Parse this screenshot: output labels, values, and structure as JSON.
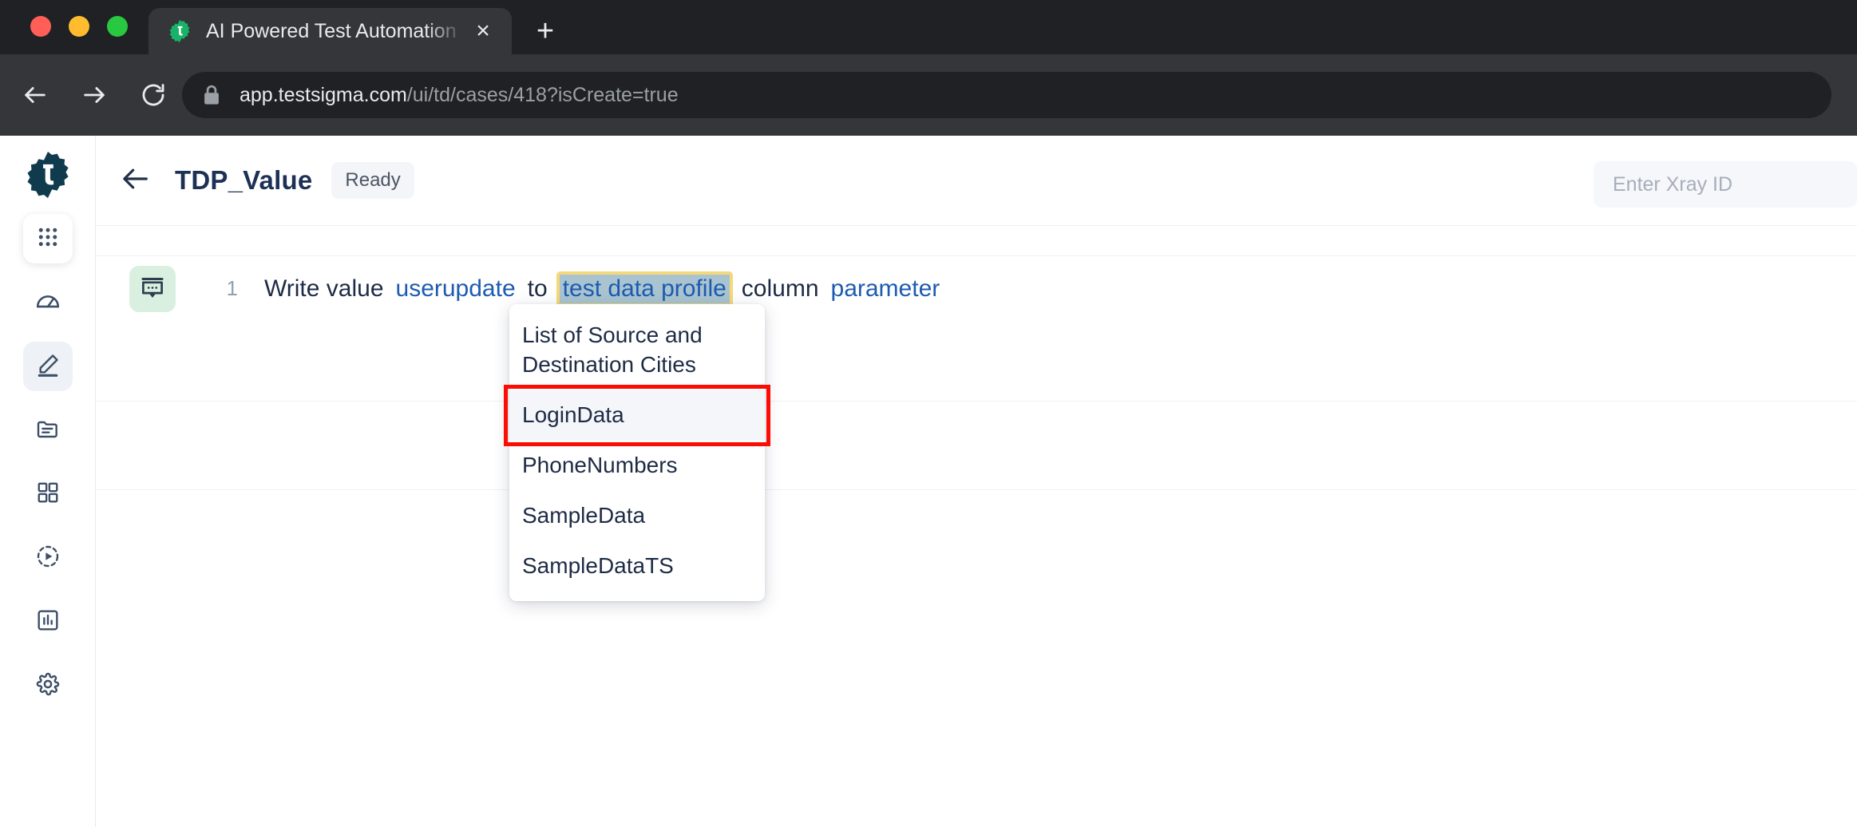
{
  "browser": {
    "tab": {
      "title": "AI Powered Test Automation Pl",
      "favicon_name": "testsigma-logo-icon",
      "close_label": "×"
    },
    "new_tab_label": "+",
    "nav": {
      "back_name": "back-button",
      "forward_name": "forward-button",
      "reload_name": "reload-button"
    },
    "omnibox": {
      "domain": "app.testsigma.com",
      "path": "/ui/td/cases/418?isCreate=true",
      "lock_icon": "lock-icon"
    }
  },
  "sidebar": {
    "logo_name": "testsigma-logo",
    "items": [
      {
        "name": "apps-grid",
        "icon": "grid-dots-icon",
        "state": "boxed"
      },
      {
        "name": "dashboard",
        "icon": "speedometer-icon",
        "state": "normal"
      },
      {
        "name": "test-development",
        "icon": "pencil-icon",
        "state": "active"
      },
      {
        "name": "test-data",
        "icon": "folder-icon",
        "state": "normal"
      },
      {
        "name": "test-plans",
        "icon": "squares-icon",
        "state": "normal"
      },
      {
        "name": "run-results",
        "icon": "play-circle-icon",
        "state": "normal"
      },
      {
        "name": "reports",
        "icon": "bar-chart-icon",
        "state": "normal"
      },
      {
        "name": "settings",
        "icon": "gear-icon",
        "state": "normal"
      }
    ]
  },
  "header": {
    "back_icon": "arrow-left-icon",
    "title": "TDP_Value",
    "status_badge": "Ready",
    "xray": {
      "placeholder": "Enter Xray ID",
      "value": ""
    }
  },
  "step": {
    "icon": "test-step-icon",
    "number": "1",
    "tokens": [
      {
        "text": "Write value",
        "kind": "plain"
      },
      {
        "text": "userupdate",
        "kind": "link"
      },
      {
        "text": "to",
        "kind": "plain"
      },
      {
        "text": "test data profile",
        "kind": "selected"
      },
      {
        "text": "column",
        "kind": "plain"
      },
      {
        "text": "parameter",
        "kind": "link"
      }
    ]
  },
  "dropdown": {
    "items": [
      {
        "label": "List of Source and Destination Cities",
        "state": "normal"
      },
      {
        "label": "LoginData",
        "state": "hovered-marked"
      },
      {
        "label": "PhoneNumbers",
        "state": "normal"
      },
      {
        "label": "SampleData",
        "state": "normal"
      },
      {
        "label": "SampleDataTS",
        "state": "normal"
      }
    ]
  },
  "colors": {
    "annotation_red": "#fb0d04",
    "selection_outline": "#f5d87a",
    "selection_fill": "#a9c4d0",
    "link_blue": "#1d5bb0",
    "brand_navy": "#1d3055",
    "step_icon_bg": "#d9f0e0",
    "tab_bar": "#202124",
    "toolbar": "#35363a"
  }
}
